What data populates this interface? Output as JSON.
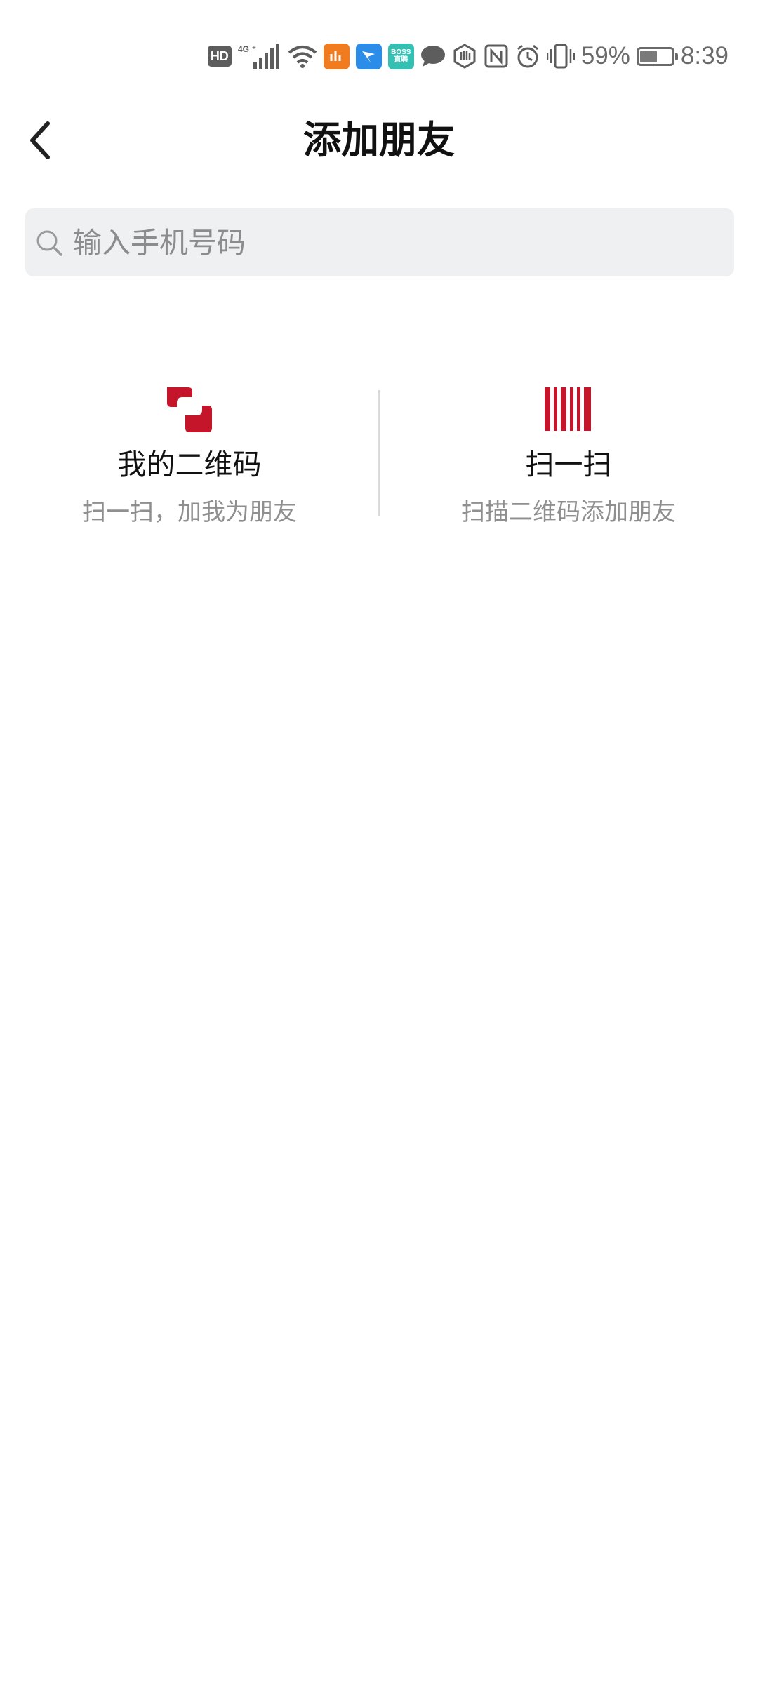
{
  "status_bar": {
    "hd_label": "HD",
    "network_label": "4G",
    "battery_text": "59%",
    "battery_level_percent": 59,
    "time": "8:39",
    "app_c_label_top": "BOSS",
    "app_c_label_bottom": "直聘"
  },
  "header": {
    "title": "添加朋友"
  },
  "search": {
    "placeholder": "输入手机号码"
  },
  "actions": [
    {
      "title": "我的二维码",
      "subtitle": "扫一扫，加我为朋友"
    },
    {
      "title": "扫一扫",
      "subtitle": "扫描二维码添加朋友"
    }
  ],
  "colors": {
    "accent": "#c4152a",
    "search_bg": "#eff0f2",
    "subtitle": "#8f8f8f"
  }
}
